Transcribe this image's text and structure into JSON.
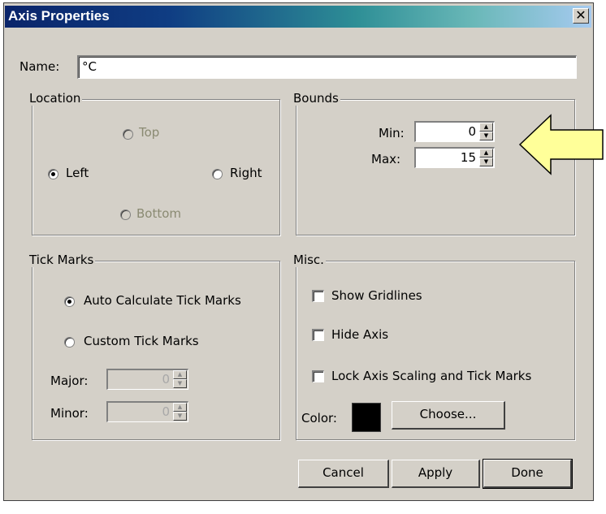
{
  "window": {
    "title": "Axis Properties",
    "close_glyph": "✕"
  },
  "name_field": {
    "label": "Name:",
    "value": "°C"
  },
  "location": {
    "legend": "Location",
    "options": {
      "top": "Top",
      "left": "Left",
      "right": "Right",
      "bottom": "Bottom"
    },
    "selected": "left"
  },
  "bounds": {
    "legend": "Bounds",
    "min_label": "Min:",
    "min_value": "0",
    "max_label": "Max:",
    "max_value": "15"
  },
  "tick_marks": {
    "legend": "Tick Marks",
    "auto_label": "Auto Calculate Tick Marks",
    "custom_label": "Custom Tick Marks",
    "selected": "auto",
    "major_label": "Major:",
    "major_value": "0",
    "minor_label": "Minor:",
    "minor_value": "0"
  },
  "misc": {
    "legend": "Misc.",
    "show_gridlines": "Show Gridlines",
    "hide_axis": "Hide Axis",
    "lock_axis": "Lock Axis Scaling and Tick Marks",
    "color_label": "Color:",
    "color_value": "#000000",
    "choose_label": "Choose..."
  },
  "buttons": {
    "cancel": "Cancel",
    "apply": "Apply",
    "done": "Done"
  },
  "annotation": {
    "arrow_color": "#ffff99",
    "arrow_stroke": "#000000"
  }
}
